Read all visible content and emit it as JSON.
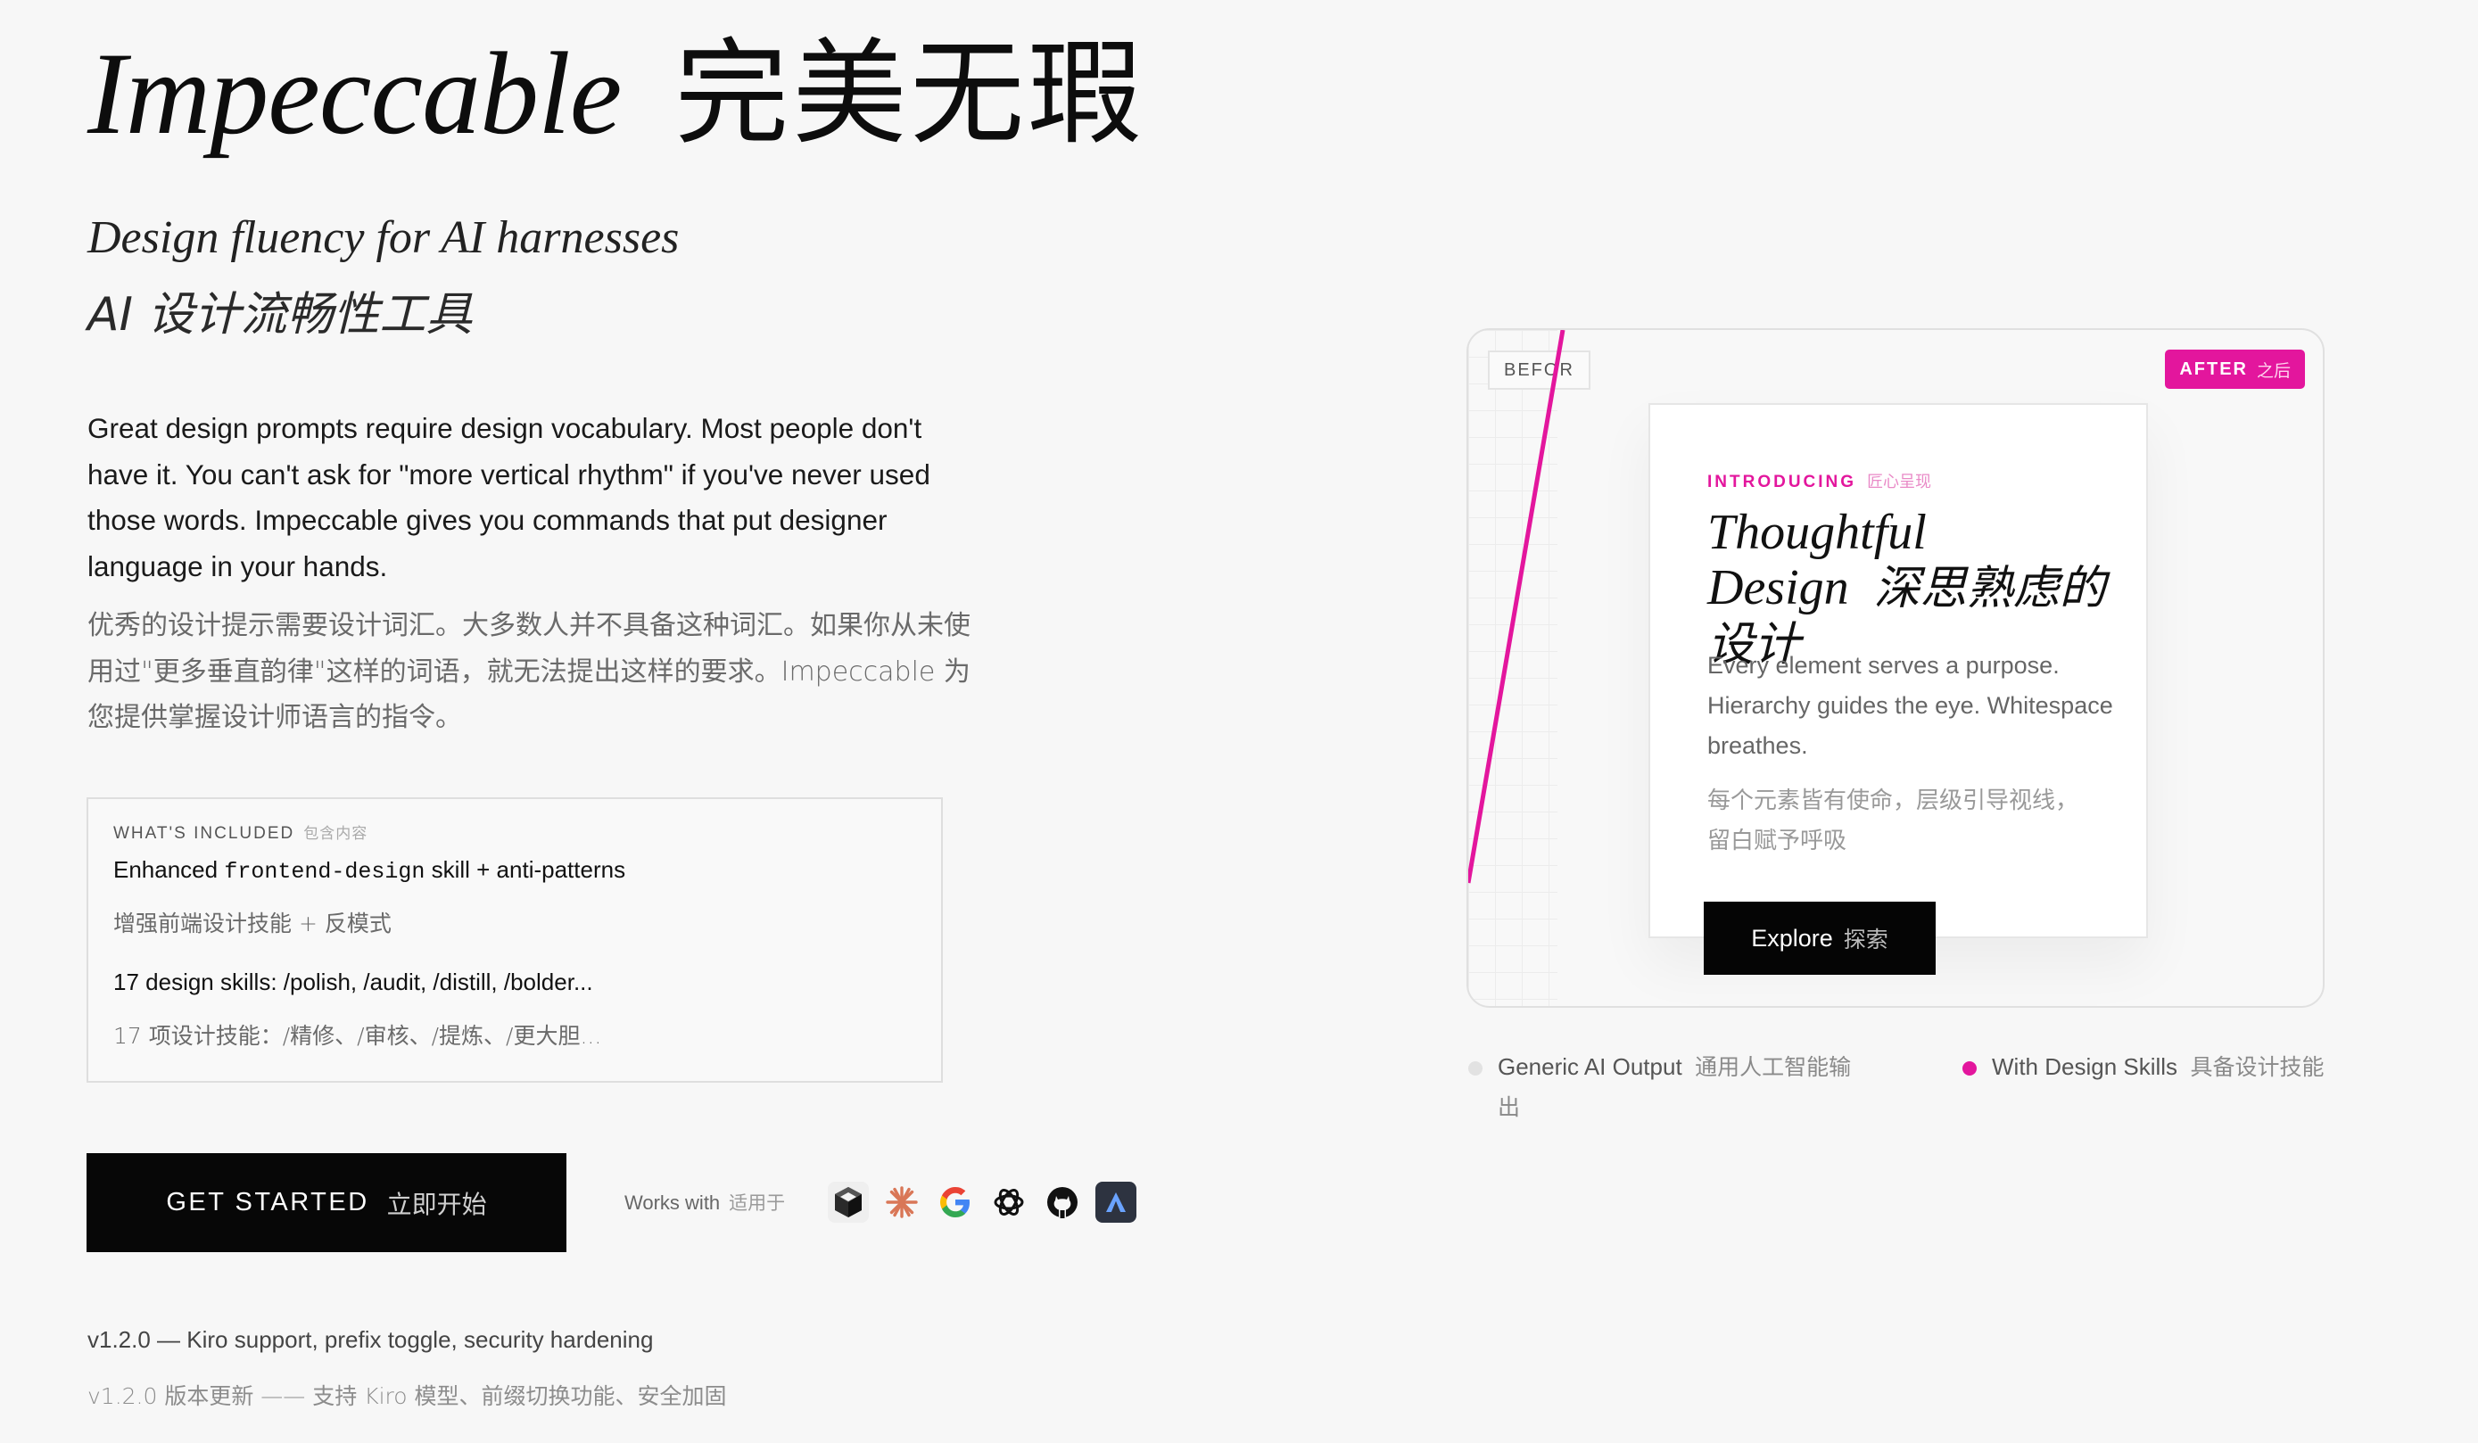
{
  "hero": {
    "title_en": "Impeccable",
    "title_zh": "完美无瑕",
    "tagline_en": "Design fluency for AI harnesses",
    "tagline_zh": "AI 设计流畅性工具"
  },
  "description": {
    "en": "Great design prompts require design vocabulary. Most people don't have it. You can't ask for \"more vertical rhythm\" if you've never used those words. Impeccable gives you commands that put designer language in your hands.",
    "zh": "优秀的设计提示需要设计词汇。大多数人并不具备这种词汇。如果你从未使用过\"更多垂直韵律\"这样的词语，就无法提出这样的要求。Impeccable 为您提供掌握设计师语言的指令。"
  },
  "included": {
    "label_en": "WHAT'S INCLUDED",
    "label_zh": "包含内容",
    "item1_pre": "Enhanced ",
    "item1_code": "frontend-design",
    "item1_post": " skill + anti-patterns",
    "item1_zh": "增强前端设计技能 + 反模式",
    "item2_en": "17 design skills: /polish, /audit, /distill, /bolder...",
    "item2_zh": "17 项设计技能：/精修、/审核、/提炼、/更大胆..."
  },
  "cta": {
    "label_en": "GET STARTED",
    "label_zh": "立即开始"
  },
  "works_with": {
    "label_en": "Works with",
    "label_zh": "适用于",
    "tools": [
      "cursor-icon",
      "claude-icon",
      "google-gemini-icon",
      "openai-icon",
      "github-icon",
      "antigravity-icon"
    ]
  },
  "version": {
    "en": "v1.2.0 — Kiro support, prefix toggle, security hardening",
    "zh": "v1.2.0 版本更新 —— 支持 Kiro 模型、前缀切换功能、安全加固"
  },
  "compare": {
    "before_label": "BEFOR",
    "after_label_en": "AFTER",
    "after_label_zh": "之后",
    "card": {
      "intro_en": "INTRODUCING",
      "intro_zh": "匠心呈现",
      "title_en": "Thoughtful Design",
      "title_zh": "深思熟虑的设计",
      "body_en": "Every element serves a purpose. Hierarchy guides the eye. Whitespace breathes.",
      "body_zh": "每个元素皆有使命，层级引导视线，留白赋予呼吸",
      "button_en": "Explore",
      "button_zh": "探索"
    },
    "legend": [
      {
        "en": "Generic AI Output",
        "zh": "通用人工智能输出"
      },
      {
        "en": "With Design Skills",
        "zh": "具备设计技能"
      }
    ]
  },
  "colors": {
    "accent": "#e3169d",
    "text": "#111111",
    "muted": "#8a8a8a",
    "background": "#f7f7f7",
    "button_bg": "#070707"
  }
}
